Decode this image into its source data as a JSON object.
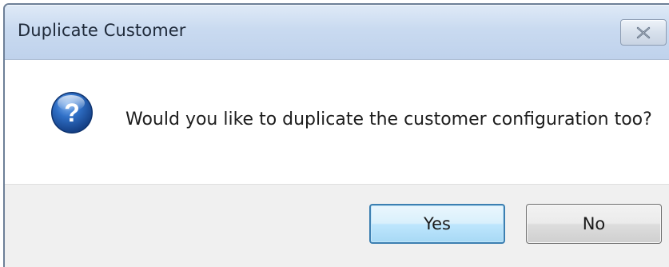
{
  "window": {
    "title": "Duplicate Customer"
  },
  "dialog": {
    "icon": "question-icon",
    "message": "Would you like to duplicate the customer configuration too?"
  },
  "buttons": {
    "yes_label": "Yes",
    "no_label": "No"
  },
  "colors": {
    "titlebar": "#c9daf0",
    "button_area": "#f0f0f0",
    "yes_border": "#3c7fb1",
    "icon_blue": "#1e5aa8"
  }
}
